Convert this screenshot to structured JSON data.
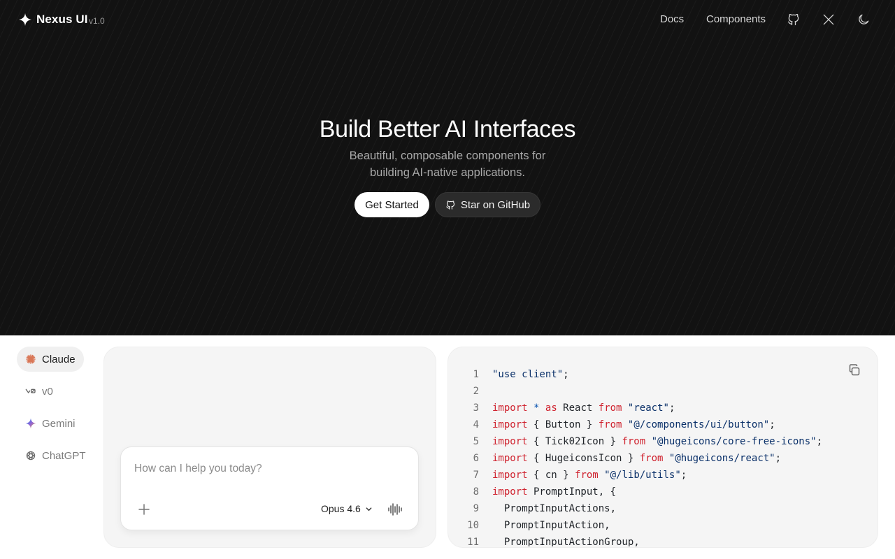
{
  "nav": {
    "brand": "Nexus UI",
    "version": "v1.0",
    "links": [
      {
        "label": "Docs"
      },
      {
        "label": "Components"
      }
    ],
    "icons": [
      "github-icon",
      "x-logo-icon",
      "moon-icon"
    ]
  },
  "hero": {
    "title": "Build Better AI Interfaces",
    "subtitle_line1": "Beautiful, composable components for",
    "subtitle_line2": "building AI-native applications.",
    "primary_button": "Get Started",
    "secondary_button": "Star on GitHub"
  },
  "models": [
    {
      "label": "Claude",
      "icon": "claude-icon",
      "active": true
    },
    {
      "label": "v0",
      "icon": "v0-icon",
      "active": false
    },
    {
      "label": "Gemini",
      "icon": "gemini-icon",
      "active": false
    },
    {
      "label": "ChatGPT",
      "icon": "chatgpt-icon",
      "active": false
    }
  ],
  "prompt": {
    "placeholder": "How can I help you today?",
    "model": "Opus 4.6"
  },
  "code": {
    "lines": [
      {
        "n": "1",
        "tokens": [
          {
            "t": "str",
            "v": "\"use client\""
          },
          {
            "t": "plain",
            "v": ";"
          }
        ]
      },
      {
        "n": "2",
        "tokens": []
      },
      {
        "n": "3",
        "tokens": [
          {
            "t": "kw",
            "v": "import"
          },
          {
            "t": "plain",
            "v": " "
          },
          {
            "t": "op",
            "v": "*"
          },
          {
            "t": "plain",
            "v": " "
          },
          {
            "t": "kw",
            "v": "as"
          },
          {
            "t": "plain",
            "v": " React "
          },
          {
            "t": "kw",
            "v": "from"
          },
          {
            "t": "plain",
            "v": " "
          },
          {
            "t": "str",
            "v": "\"react\""
          },
          {
            "t": "plain",
            "v": ";"
          }
        ]
      },
      {
        "n": "4",
        "tokens": [
          {
            "t": "kw",
            "v": "import"
          },
          {
            "t": "plain",
            "v": " { Button } "
          },
          {
            "t": "kw",
            "v": "from"
          },
          {
            "t": "plain",
            "v": " "
          },
          {
            "t": "str",
            "v": "\"@/components/ui/button\""
          },
          {
            "t": "plain",
            "v": ";"
          }
        ]
      },
      {
        "n": "5",
        "tokens": [
          {
            "t": "kw",
            "v": "import"
          },
          {
            "t": "plain",
            "v": " { Tick02Icon } "
          },
          {
            "t": "kw",
            "v": "from"
          },
          {
            "t": "plain",
            "v": " "
          },
          {
            "t": "str",
            "v": "\"@hugeicons/core-free-icons\""
          },
          {
            "t": "plain",
            "v": ";"
          }
        ]
      },
      {
        "n": "6",
        "tokens": [
          {
            "t": "kw",
            "v": "import"
          },
          {
            "t": "plain",
            "v": " { HugeiconsIcon } "
          },
          {
            "t": "kw",
            "v": "from"
          },
          {
            "t": "plain",
            "v": " "
          },
          {
            "t": "str",
            "v": "\"@hugeicons/react\""
          },
          {
            "t": "plain",
            "v": ";"
          }
        ]
      },
      {
        "n": "7",
        "tokens": [
          {
            "t": "kw",
            "v": "import"
          },
          {
            "t": "plain",
            "v": " { cn } "
          },
          {
            "t": "kw",
            "v": "from"
          },
          {
            "t": "plain",
            "v": " "
          },
          {
            "t": "str",
            "v": "\"@/lib/utils\""
          },
          {
            "t": "plain",
            "v": ";"
          }
        ]
      },
      {
        "n": "8",
        "tokens": [
          {
            "t": "kw",
            "v": "import"
          },
          {
            "t": "plain",
            "v": " PromptInput, {"
          }
        ]
      },
      {
        "n": "9",
        "tokens": [
          {
            "t": "plain",
            "v": "  PromptInputActions,"
          }
        ]
      },
      {
        "n": "10",
        "tokens": [
          {
            "t": "plain",
            "v": "  PromptInputAction,"
          }
        ]
      },
      {
        "n": "11",
        "tokens": [
          {
            "t": "plain",
            "v": "  PromptInputActionGroup,"
          }
        ]
      }
    ]
  },
  "colors": {
    "hero_bg": "#121212",
    "keyword": "#cf222e",
    "string": "#0a3069",
    "operator": "#0550ae",
    "claude": "#d97757",
    "gemini": "#4f8ef7"
  }
}
